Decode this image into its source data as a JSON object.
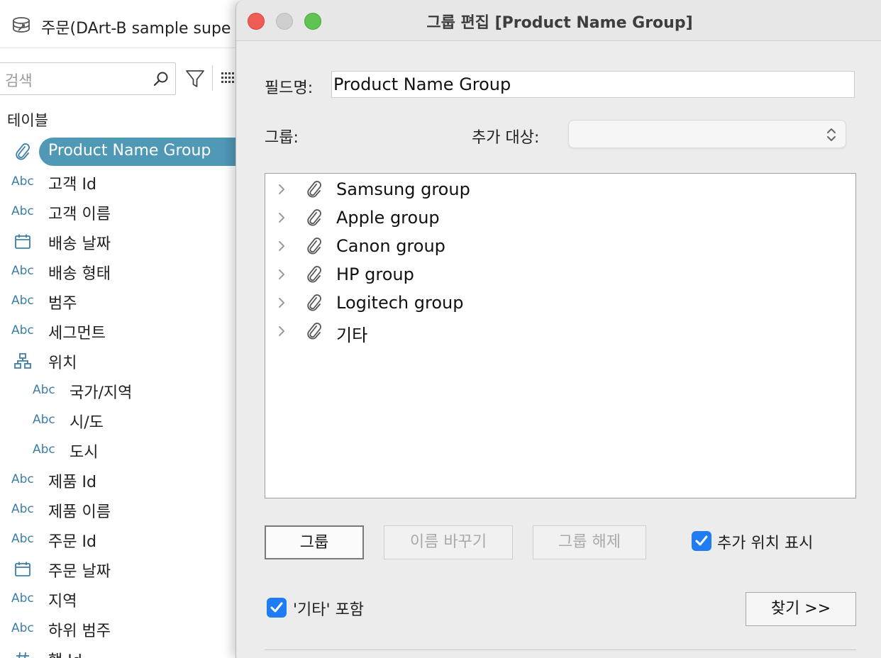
{
  "datasource": {
    "name": "주문(DArt-B sample supe",
    "icon": "datasource-icon"
  },
  "search": {
    "placeholder": "검색"
  },
  "section_title": "테이블",
  "fields": [
    {
      "type": "clip",
      "label": "Product Name Group",
      "selected": true
    },
    {
      "type": "Abc",
      "label": "고객 Id"
    },
    {
      "type": "Abc",
      "label": "고객 이름"
    },
    {
      "type": "date",
      "label": "배송 날짜"
    },
    {
      "type": "Abc",
      "label": "배송 형태"
    },
    {
      "type": "Abc",
      "label": "범주"
    },
    {
      "type": "Abc",
      "label": "세그먼트"
    },
    {
      "type": "hierarchy",
      "label": "위치"
    },
    {
      "type": "Abc",
      "label": "국가/지역",
      "indent": true
    },
    {
      "type": "Abc",
      "label": "시/도",
      "indent": true
    },
    {
      "type": "Abc",
      "label": "도시",
      "indent": true
    },
    {
      "type": "Abc",
      "label": "제품 Id"
    },
    {
      "type": "Abc",
      "label": "제품 이름"
    },
    {
      "type": "Abc",
      "label": "주문 Id"
    },
    {
      "type": "date",
      "label": "주문 날짜"
    },
    {
      "type": "Abc",
      "label": "지역"
    },
    {
      "type": "Abc",
      "label": "하위 범주"
    },
    {
      "type": "#",
      "label": "행 Id"
    }
  ],
  "dialog": {
    "title": "그룹 편집 [Product Name Group]",
    "field_name_label": "필드명:",
    "field_name_value": "Product Name Group",
    "group_label": "그룹:",
    "add_to_label": "추가 대상:",
    "add_to_value": "",
    "groups": [
      "Samsung group",
      "Apple group",
      "Canon group",
      "HP group",
      "Logitech group",
      "기타"
    ],
    "buttons": {
      "group": "그룹",
      "rename": "이름 바꾸기",
      "ungroup": "그룹 해제",
      "find": "찾기 >>"
    },
    "show_added_label": "추가 위치 표시",
    "include_other_label": "'기타' 포함",
    "show_added_checked": true,
    "include_other_checked": true
  },
  "colors": {
    "accent": "#4f98b6",
    "type_icon": "#3c7ea8",
    "checkbox": "#1f7cf3"
  }
}
